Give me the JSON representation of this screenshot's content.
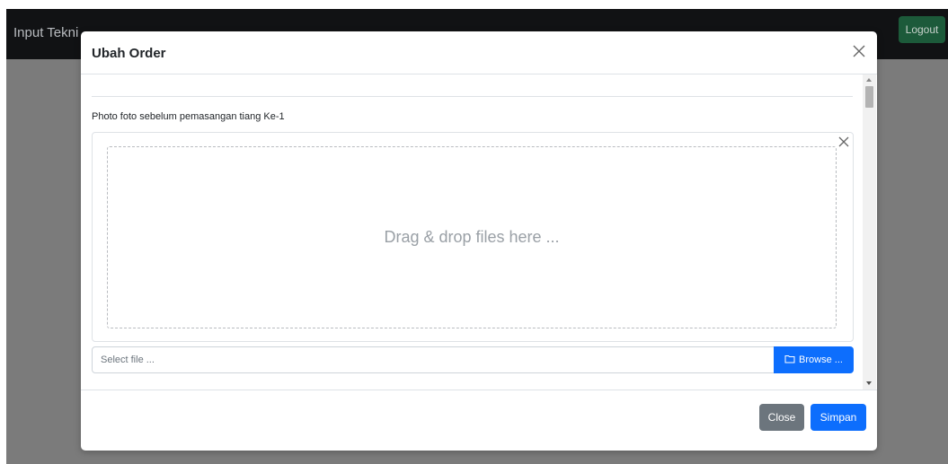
{
  "navbar": {
    "brand": "Input Tekni",
    "logout_label": "Logout"
  },
  "modal": {
    "title": "Ubah Order",
    "field_label": "Photo foto sebelum pemasangan tiang Ke-1",
    "drop_text": "Drag & drop files here ...",
    "file_placeholder": "Select file ...",
    "browse_label": "Browse ...",
    "close_label": "Close",
    "save_label": "Simpan"
  },
  "icons": {
    "modal_close": "close-icon",
    "preview_close": "close-icon",
    "browse": "folder-icon"
  },
  "colors": {
    "primary": "#0d6efd",
    "secondary": "#6c757d",
    "logout": "#1c5a3a",
    "navbar": "#111214"
  }
}
